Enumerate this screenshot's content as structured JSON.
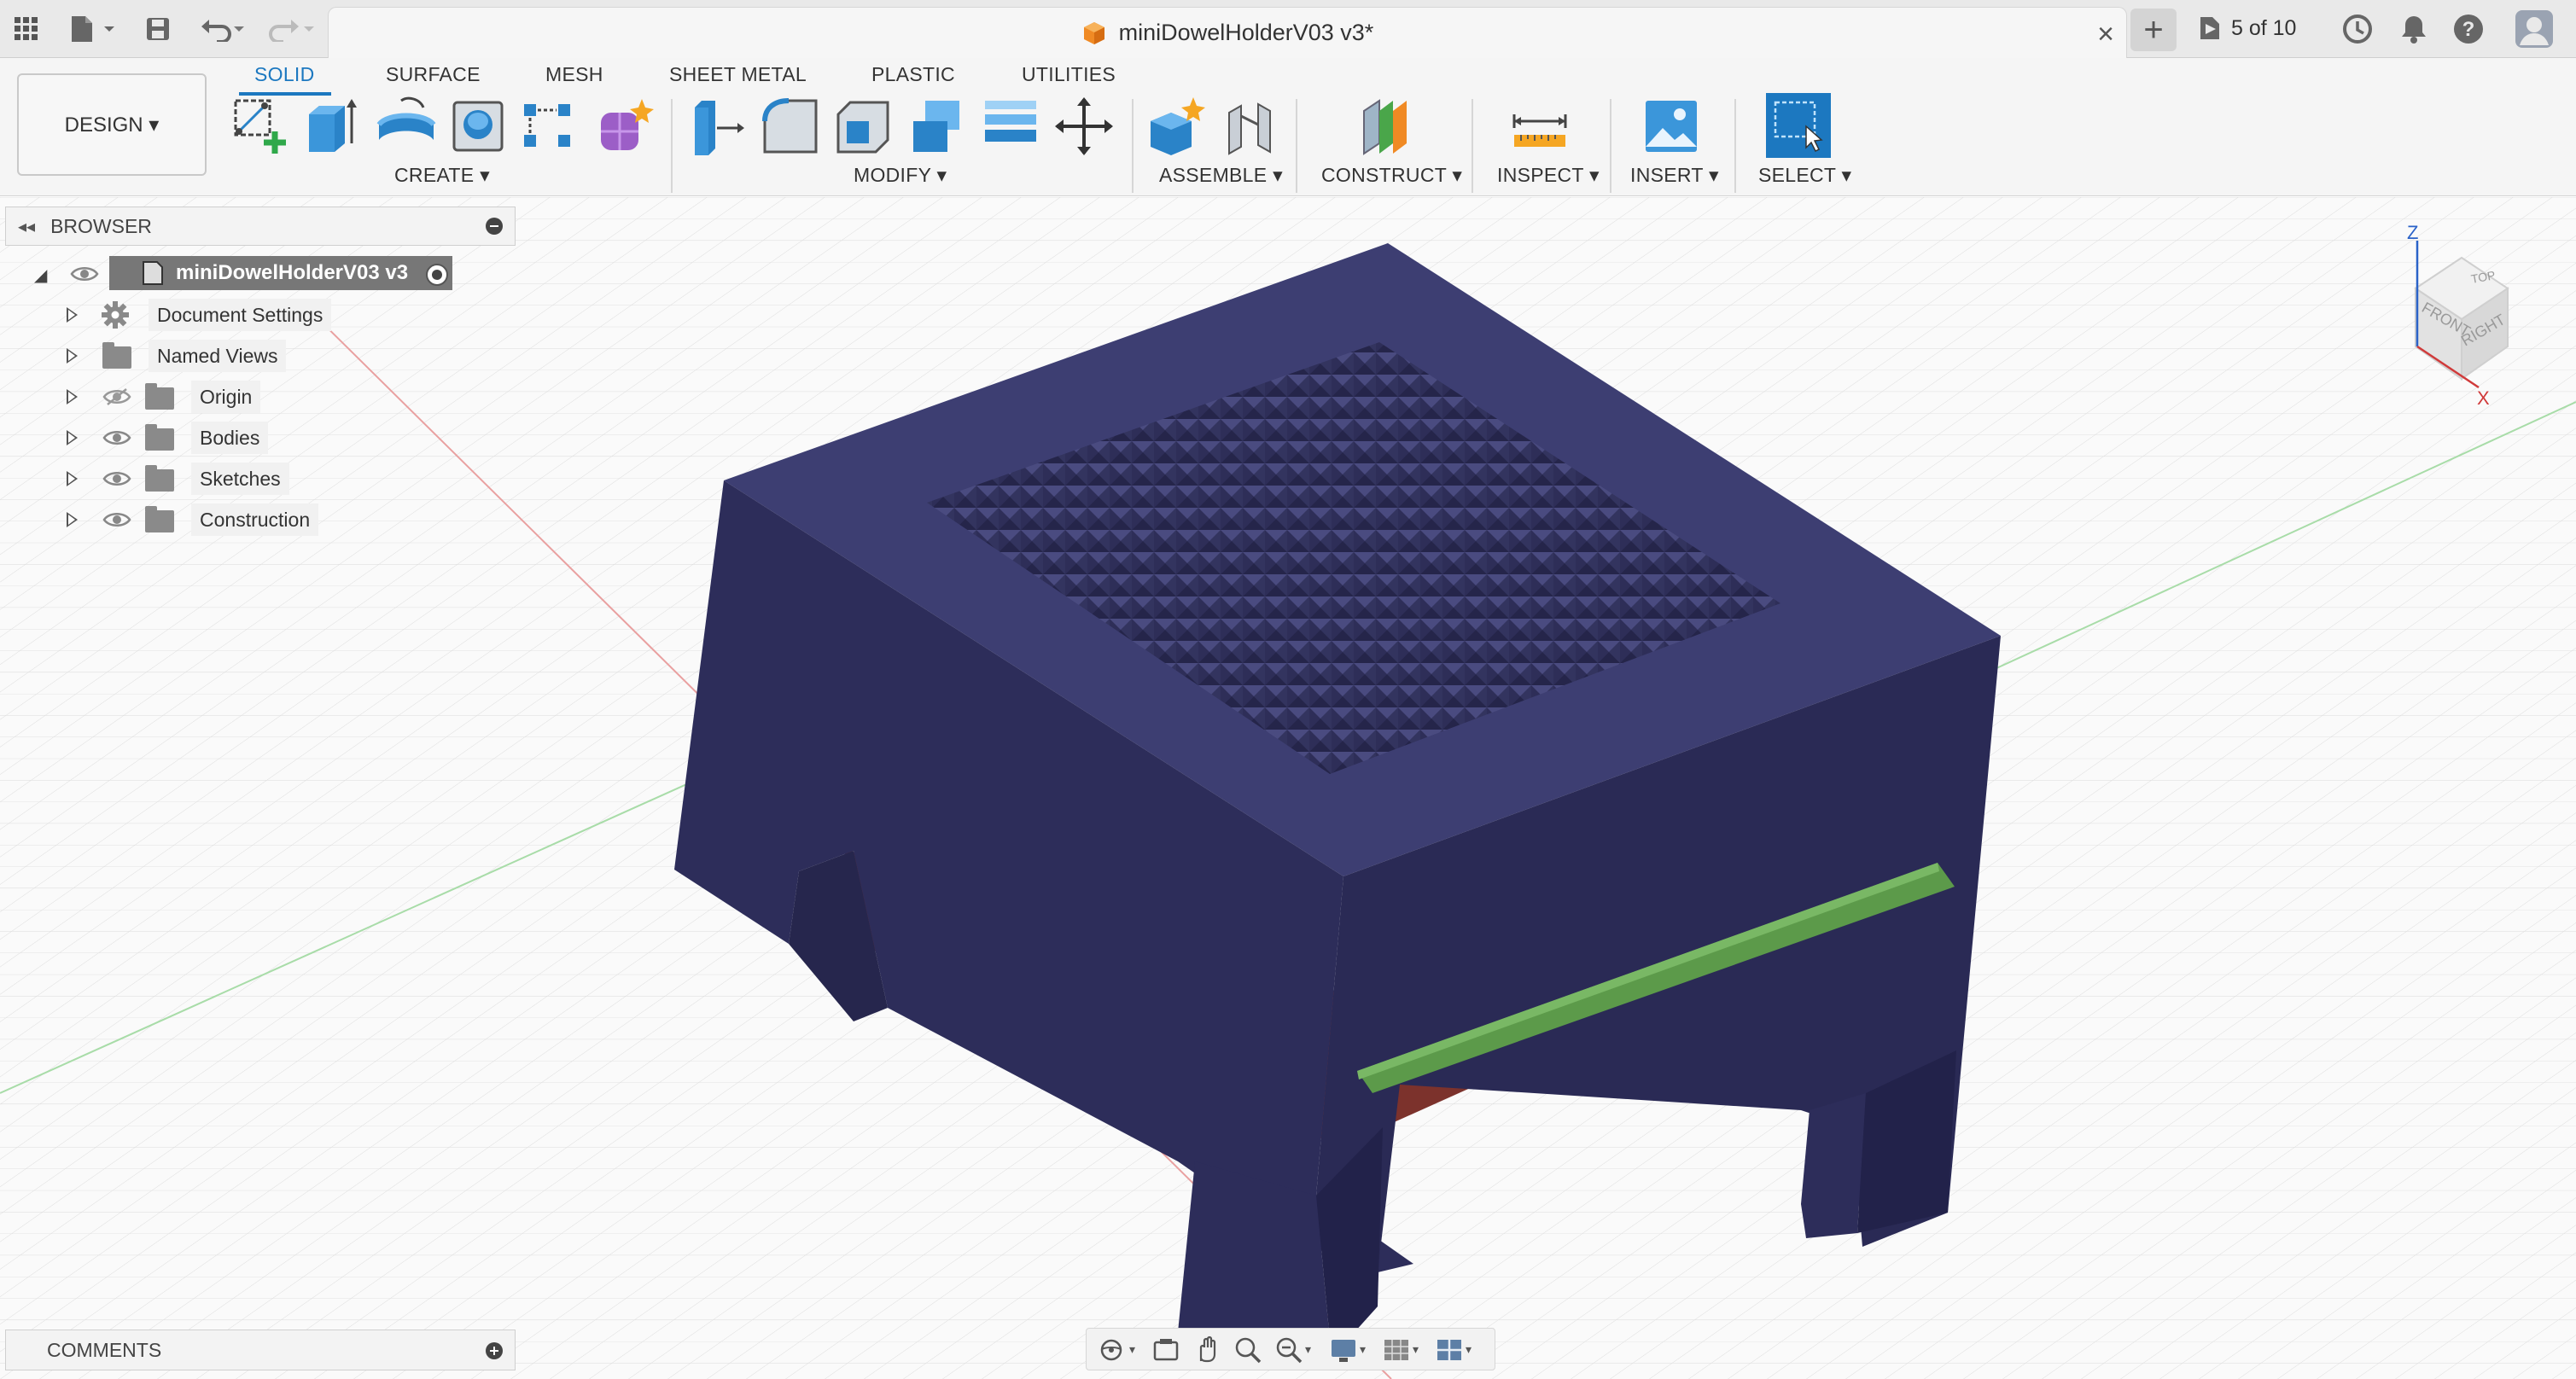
{
  "app": {
    "document_title": "miniDowelHolderV03 v3*",
    "version_label": "5 of 10"
  },
  "workspace": {
    "switcher_label": "DESIGN ▾",
    "tabs": [
      {
        "label": "SOLID",
        "active": true
      },
      {
        "label": "SURFACE",
        "active": false
      },
      {
        "label": "MESH",
        "active": false
      },
      {
        "label": "SHEET METAL",
        "active": false
      },
      {
        "label": "PLASTIC",
        "active": false
      },
      {
        "label": "UTILITIES",
        "active": false
      }
    ],
    "groups": [
      {
        "label": "CREATE ▾"
      },
      {
        "label": "MODIFY ▾"
      },
      {
        "label": "ASSEMBLE ▾"
      },
      {
        "label": "CONSTRUCT ▾"
      },
      {
        "label": "INSPECT ▾"
      },
      {
        "label": "INSERT ▾"
      },
      {
        "label": "SELECT ▾"
      }
    ]
  },
  "browser": {
    "header": "BROWSER",
    "root": "miniDowelHolderV03 v3",
    "items": [
      {
        "label": "Document Settings",
        "icon": "gear-icon"
      },
      {
        "label": "Named Views",
        "icon": "folder-icon"
      },
      {
        "label": "Origin",
        "icon": "folder-icon",
        "visibility": "hidden"
      },
      {
        "label": "Bodies",
        "icon": "folder-icon",
        "visibility": "visible"
      },
      {
        "label": "Sketches",
        "icon": "folder-icon",
        "visibility": "visible"
      },
      {
        "label": "Construction",
        "icon": "folder-icon",
        "visibility": "visible"
      }
    ]
  },
  "comments": {
    "header": "COMMENTS"
  },
  "viewcube": {
    "top": "TOP",
    "front": "FRONT",
    "right": "RIGHT",
    "axis_z": "Z",
    "axis_x": "X"
  },
  "colors": {
    "accent": "#1c78c0",
    "body_top": "#3d3e72",
    "body_front": "#2d2d5a",
    "body_side": "#363667",
    "red_part": "#8d3a33",
    "green_part": "#5c9a4a"
  }
}
